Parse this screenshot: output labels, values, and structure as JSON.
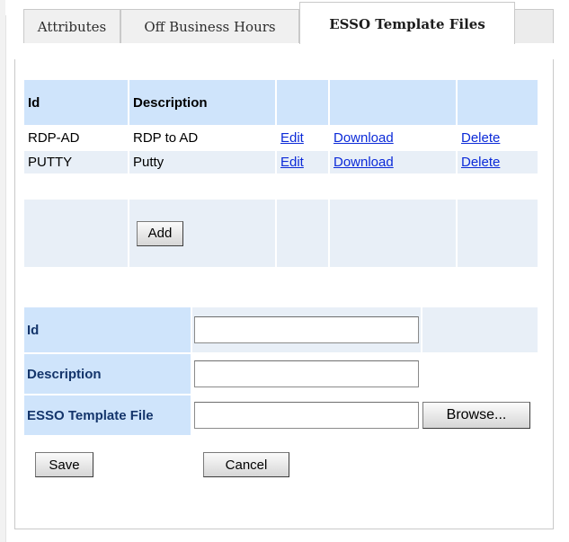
{
  "tabs": [
    {
      "label": "Attributes",
      "active": false
    },
    {
      "label": "Off Business Hours",
      "active": false
    },
    {
      "label": "ESSO Template Files",
      "active": true
    }
  ],
  "grid": {
    "headers": [
      "Id",
      "Description",
      "",
      "",
      ""
    ],
    "rows": [
      {
        "id": "RDP-AD",
        "description": "RDP to AD",
        "edit": "Edit",
        "download": "Download",
        "delete": "Delete"
      },
      {
        "id": "PUTTY",
        "description": "Putty",
        "edit": "Edit",
        "download": "Download",
        "delete": "Delete"
      }
    ],
    "add_label": "Add"
  },
  "form": {
    "id_label": "Id",
    "id_value": "",
    "description_label": "Description",
    "description_value": "",
    "file_label": "ESSO Template File",
    "file_value": "",
    "browse_label": "Browse...",
    "save_label": "Save",
    "cancel_label": "Cancel"
  },
  "colors": {
    "header_bg": "#cfe4fb",
    "row_alt_bg": "#e8eff7",
    "link": "#0b2ad8",
    "form_label_text": "#14356b"
  }
}
